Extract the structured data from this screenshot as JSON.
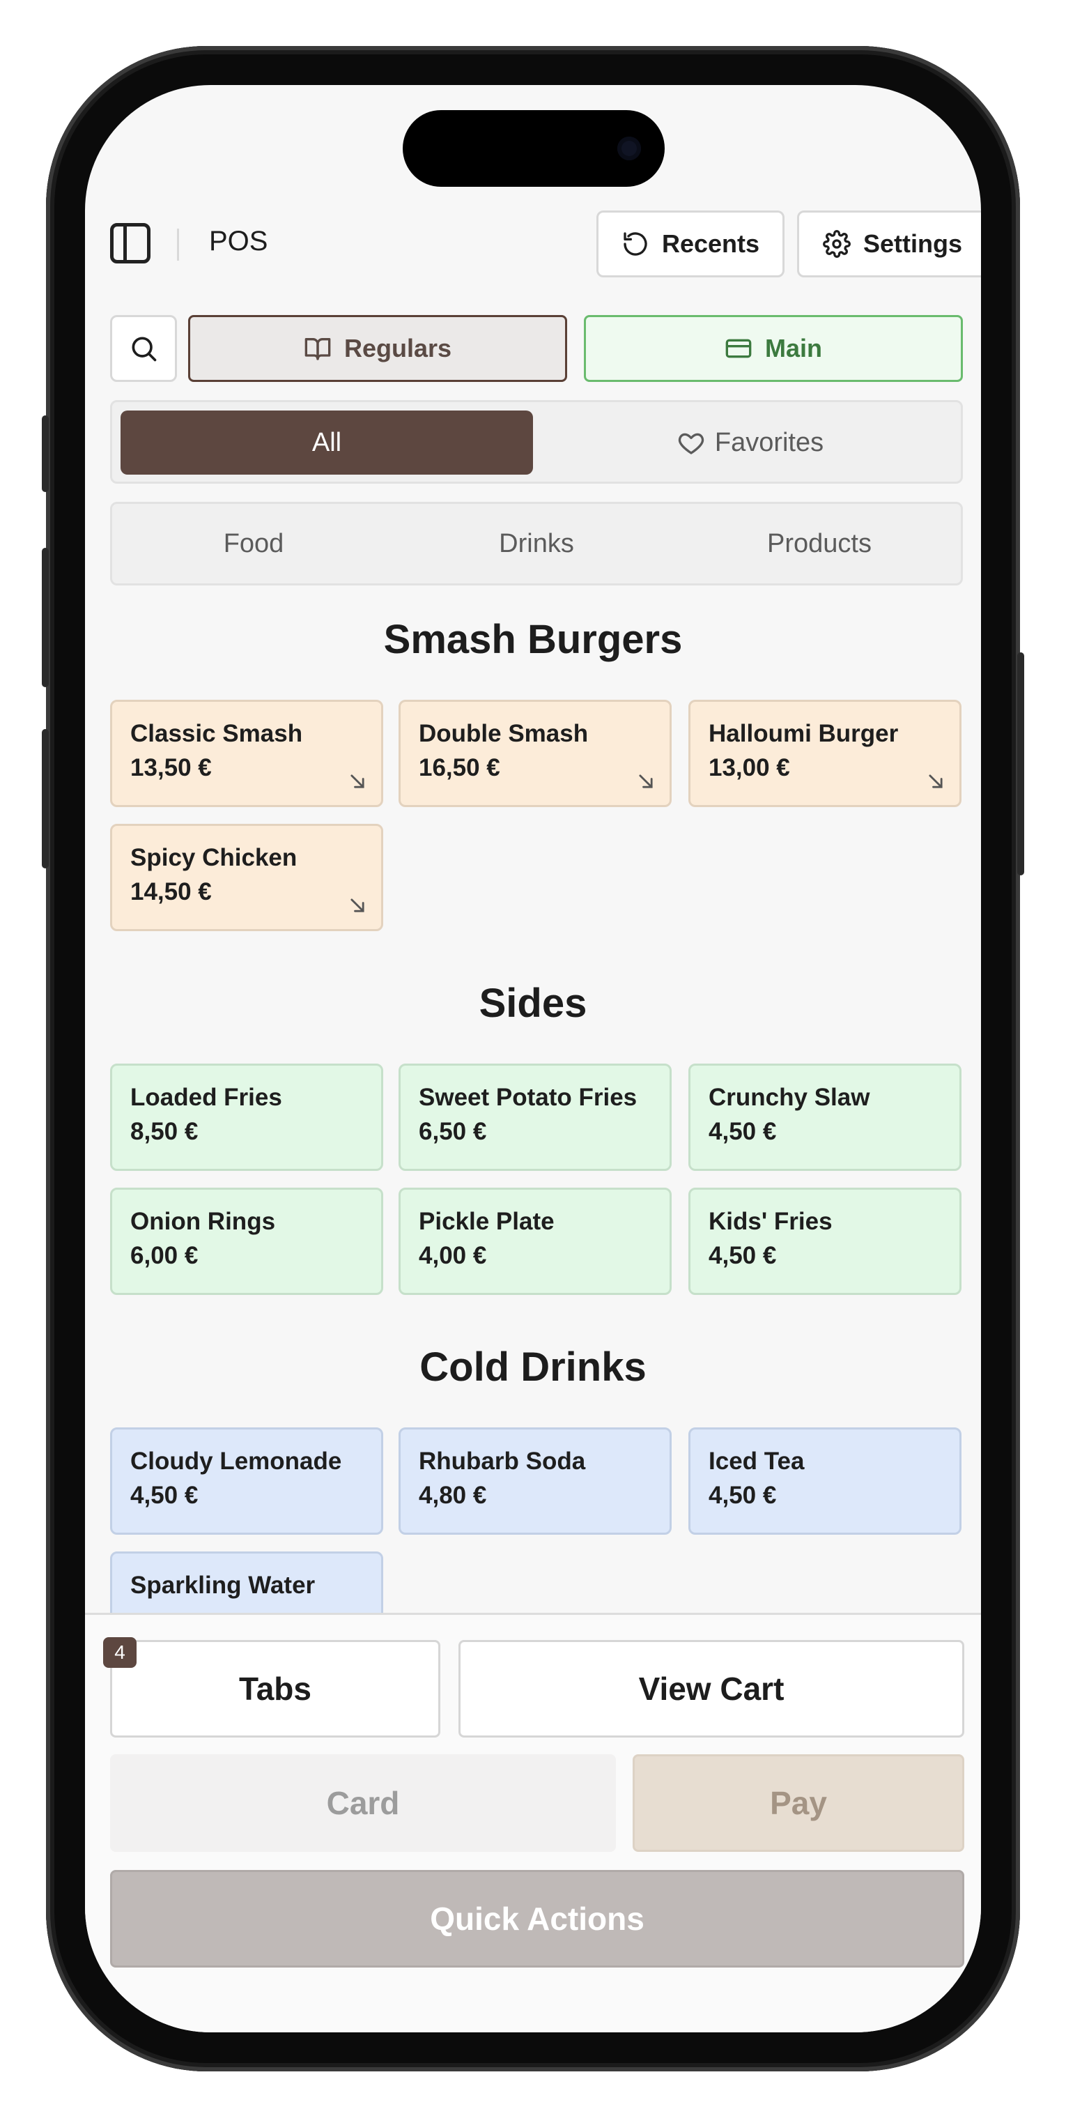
{
  "header": {
    "title": "POS",
    "recents_label": "Recents",
    "settings_label": "Settings"
  },
  "filters": {
    "regulars_label": "Regulars",
    "main_label": "Main"
  },
  "scope_tabs": [
    {
      "label": "All",
      "selected": true
    },
    {
      "label": "Favorites",
      "selected": false
    }
  ],
  "category_tabs": [
    "Food",
    "Drinks",
    "Products"
  ],
  "sections": [
    {
      "title": "Smash Burgers",
      "color": "#fcecd9",
      "items": [
        {
          "name": "Classic Smash",
          "price": "13,50 €",
          "has_options": true
        },
        {
          "name": "Double Smash",
          "price": "16,50 €",
          "has_options": true
        },
        {
          "name": "Halloumi Burger",
          "price": "13,00 €",
          "has_options": true
        },
        {
          "name": "Spicy Chicken",
          "price": "14,50 €",
          "has_options": true
        }
      ]
    },
    {
      "title": "Sides",
      "color": "#e2f8e6",
      "items": [
        {
          "name": "Loaded Fries",
          "price": "8,50 €"
        },
        {
          "name": "Sweet Potato Fries",
          "price": "6,50 €"
        },
        {
          "name": "Crunchy Slaw",
          "price": "4,50 €"
        },
        {
          "name": "Onion Rings",
          "price": "6,00 €"
        },
        {
          "name": "Pickle Plate",
          "price": "4,00 €"
        },
        {
          "name": "Kids' Fries",
          "price": "4,50 €"
        }
      ]
    },
    {
      "title": "Cold Drinks",
      "color": "#dde8fa",
      "items": [
        {
          "name": "Cloudy Lemonade",
          "price": "4,50 €"
        },
        {
          "name": "Rhubarb Soda",
          "price": "4,80 €"
        },
        {
          "name": "Iced Tea",
          "price": "4,50 €"
        },
        {
          "name": "Sparkling Water",
          "price": ""
        }
      ]
    }
  ],
  "footer": {
    "tabs_label": "Tabs",
    "tabs_count": "4",
    "view_cart_label": "View Cart",
    "card_label": "Card",
    "pay_label": "Pay",
    "quick_actions_label": "Quick Actions"
  },
  "icons": {
    "sidebar": "sidebar-toggle-icon",
    "recents": "history-icon",
    "settings": "gear-icon",
    "search": "search-icon",
    "regulars": "book-open-icon",
    "main": "credit-card-icon",
    "favorites": "heart-icon",
    "item_options": "arrow-down-right-icon"
  }
}
